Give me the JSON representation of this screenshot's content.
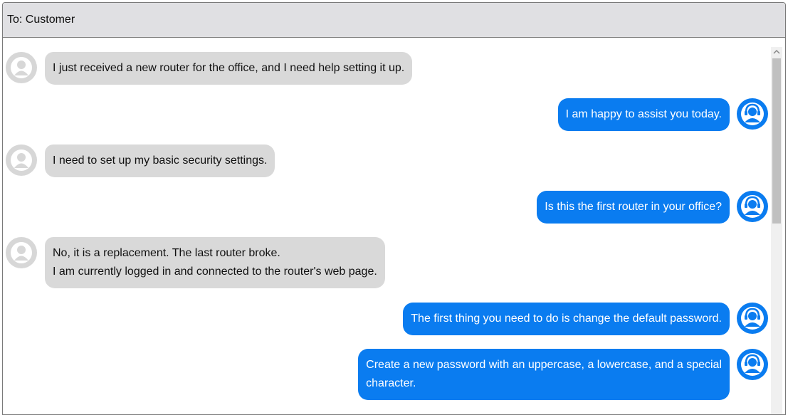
{
  "header": {
    "to_label": "To: Customer"
  },
  "messages": [
    {
      "from": "customer",
      "text": "I just received a new router for the office, and I need help setting it up."
    },
    {
      "from": "agent",
      "text": "I am happy to assist you today."
    },
    {
      "from": "customer",
      "text": "I need to set up my basic security settings."
    },
    {
      "from": "agent",
      "text": "Is this the first router in your office?"
    },
    {
      "from": "customer",
      "text": "No, it is a replacement. The last router broke.\nI am currently logged in and connected to the router's web page."
    },
    {
      "from": "agent",
      "text": "The first thing you need to do is change the default password."
    },
    {
      "from": "agent",
      "text": "Create a new password with an uppercase, a lowercase, and a special\ncharacter."
    }
  ],
  "icons": {
    "customer_avatar": "user-avatar-icon",
    "agent_avatar": "headset-agent-icon",
    "scroll_up": "chevron-up-icon"
  },
  "colors": {
    "agent_bubble": "#0a7cf0",
    "customer_bubble": "#d9d9d9",
    "header_bg": "#e0e0e3"
  }
}
